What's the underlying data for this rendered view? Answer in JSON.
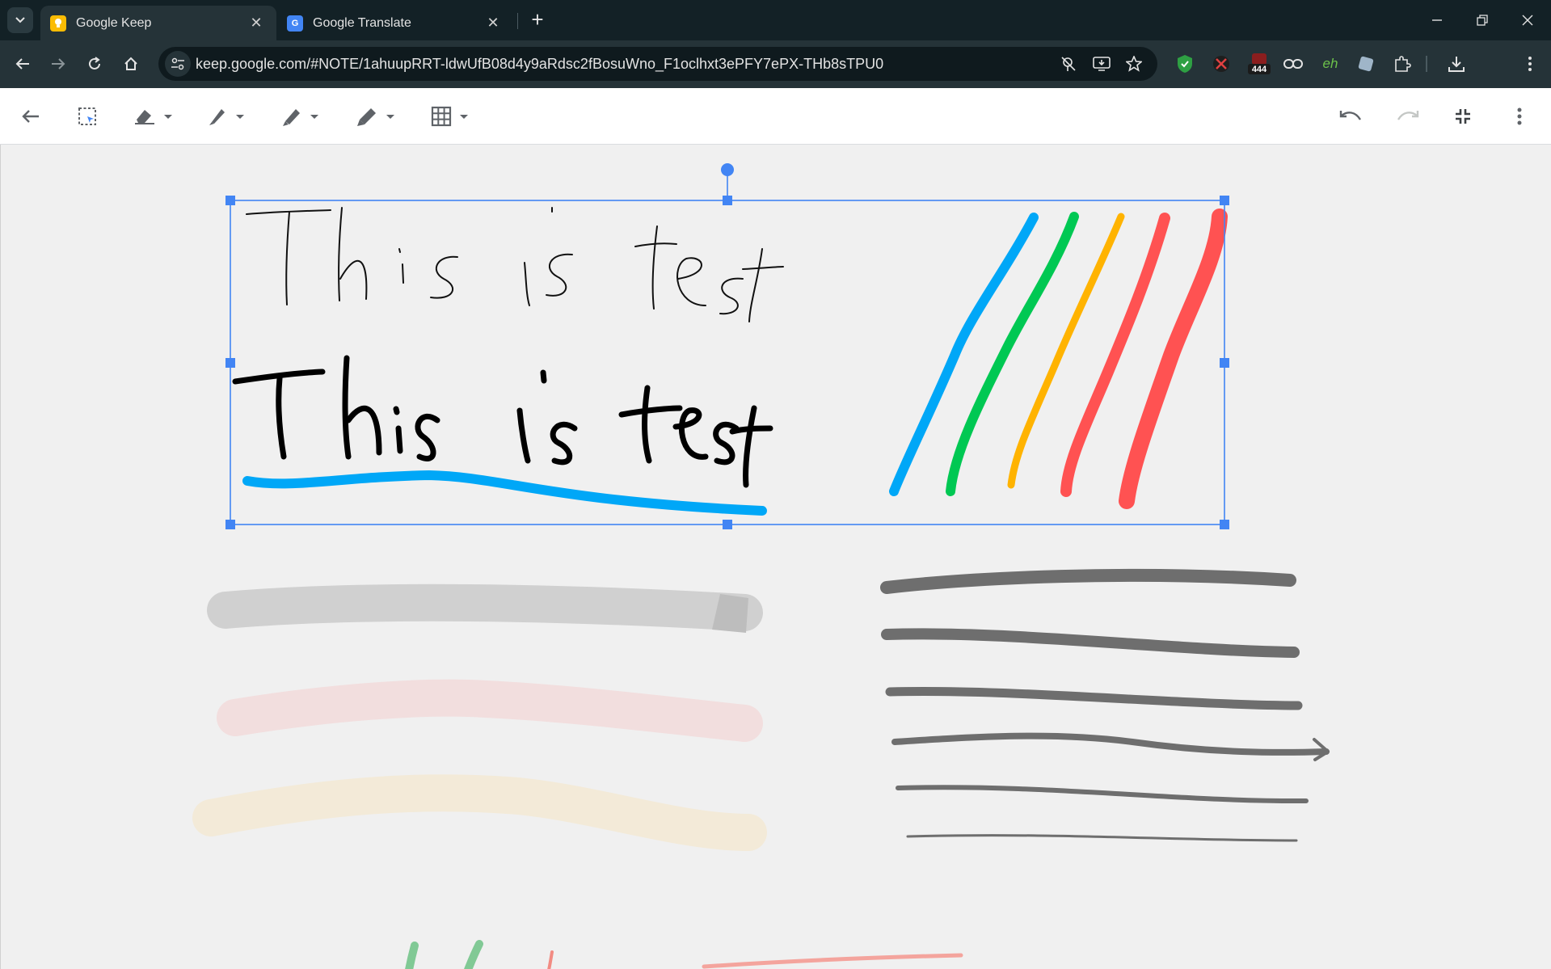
{
  "browser": {
    "tabs": [
      {
        "title": "Google Keep",
        "active": true
      },
      {
        "title": "Google Translate",
        "active": false
      }
    ],
    "url": "keep.google.com/#NOTE/1ahuupRRT-ldwUfB08d4y9aRdsc2fBosuWno_F1oclhxt3ePFY7ePX-THb8sTPU0",
    "extension_badge": "444",
    "extension_eh_label": "eh"
  },
  "drawing_toolbar": {
    "tools": [
      "back-arrow",
      "select",
      "eraser",
      "pen",
      "marker",
      "highlighter",
      "grid"
    ],
    "right_tools": [
      "undo",
      "redo",
      "exit-fullscreen",
      "more"
    ]
  },
  "canvas": {
    "colors": {
      "blue": "#00a7f7",
      "green": "#00c853",
      "yellow": "#ffb300",
      "red": "#ff5252",
      "gray": "#6e6e6e",
      "selection": "#4285f4"
    }
  }
}
